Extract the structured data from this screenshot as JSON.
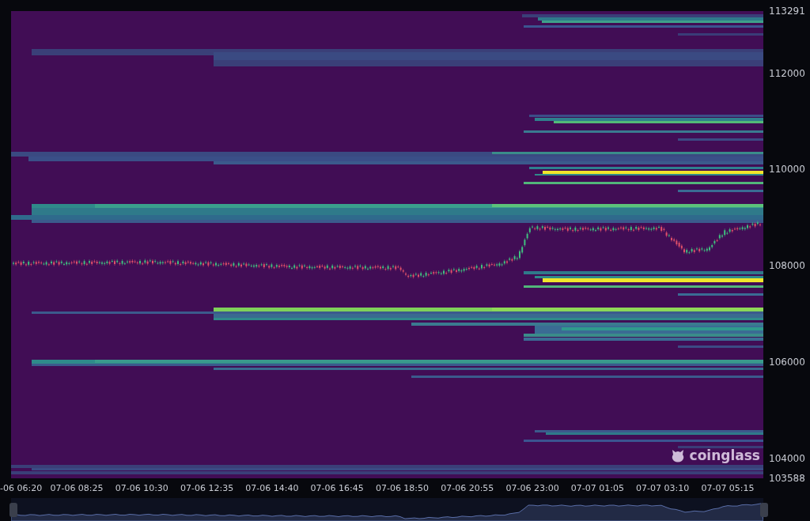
{
  "price_axis": {
    "ticks": [
      "113291",
      "112000",
      "110000",
      "108000",
      "106000",
      "104000",
      "103588"
    ]
  },
  "time_axis": {
    "ticks": [
      "-06 06:20",
      "07-06 08:25",
      "07-06 10:30",
      "07-06 12:35",
      "07-06 14:40",
      "07-06 16:45",
      "07-06 18:50",
      "07-06 20:55",
      "07-06 23:00",
      "07-07 01:05",
      "07-07 03:10",
      "07-07 05:15"
    ]
  },
  "watermark_logo": {
    "text": "coinglass"
  }
}
